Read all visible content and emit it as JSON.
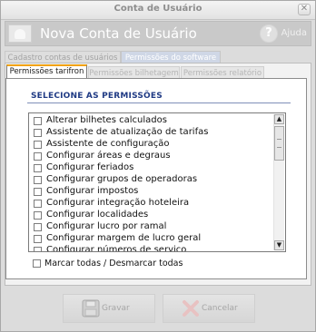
{
  "window": {
    "title": "Conta de Usuário",
    "close_glyph": "✕"
  },
  "header": {
    "title": "Nova Conta de Usuário",
    "help_glyph": "?",
    "help_label": "Ajuda"
  },
  "tabs_top": [
    {
      "label": "Cadastro contas de usuários"
    },
    {
      "label": "Permissões do software"
    }
  ],
  "tabs_sub": [
    {
      "label": "Permissões tarifron"
    },
    {
      "label": "Permissões bilhetagem"
    },
    {
      "label": "Permissões relatório"
    }
  ],
  "permissions": {
    "heading": "SELECIONE AS PERMISSÕES",
    "items": [
      "Alterar bilhetes calculados",
      "Assistente de atualização de tarifas",
      "Assistente de configuração",
      "Configurar áreas e degraus",
      "Configurar feriados",
      "Configurar grupos de operadoras",
      "Configurar impostos",
      "Configurar integração hoteleira",
      "Configurar localidades",
      "Configurar lucro por ramal",
      "Configurar margem de lucro geral",
      "Configurar números de serviço"
    ],
    "mark_all_label": "Marcar todas / Desmarcar todas"
  },
  "footer": {
    "save_label": "Gravar",
    "cancel_label": "Cancelar"
  },
  "colors": {
    "accent": "#f2a20a",
    "heading": "#1f3a84"
  }
}
